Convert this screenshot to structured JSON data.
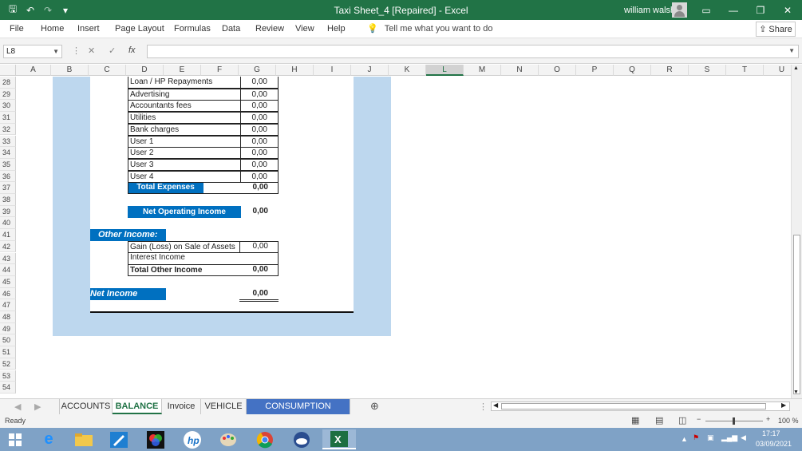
{
  "window": {
    "title": "Taxi Sheet_4 [Repaired] - Excel",
    "user": "william walsh"
  },
  "quick_access": {
    "save": "🖫",
    "undo": "↶",
    "redo": "↷",
    "customize": "▾"
  },
  "menu": [
    "File",
    "Home",
    "Insert",
    "Page Layout",
    "Formulas",
    "Data",
    "Review",
    "View",
    "Help"
  ],
  "tell_me": "Tell me what you want to do",
  "share": "Share",
  "formula_bar": {
    "name_box": "L8",
    "formula": "",
    "fx": "fx"
  },
  "columns": [
    "A",
    "B",
    "C",
    "D",
    "E",
    "F",
    "G",
    "H",
    "I",
    "J",
    "K",
    "L",
    "M",
    "N",
    "O",
    "P",
    "Q",
    "R",
    "S",
    "T",
    "U"
  ],
  "selected_column": "L",
  "rows": [
    "28",
    "29",
    "30",
    "31",
    "32",
    "33",
    "34",
    "35",
    "36",
    "37",
    "38",
    "39",
    "40",
    "41",
    "42",
    "43",
    "44",
    "45",
    "46",
    "47",
    "48",
    "49",
    "50",
    "51",
    "52",
    "53",
    "54"
  ],
  "expenses": [
    {
      "label": "Loan / HP Repayments",
      "value": "0,00"
    },
    {
      "label": "Advertising",
      "value": "0,00"
    },
    {
      "label": "Accountants fees",
      "value": "0,00"
    },
    {
      "label": "Utilities",
      "value": "0,00"
    },
    {
      "label": "Bank charges",
      "value": "0,00"
    },
    {
      "label": "User 1",
      "value": "0,00"
    },
    {
      "label": "User 2",
      "value": "0,00"
    },
    {
      "label": "User 3",
      "value": "0,00"
    },
    {
      "label": "User 4",
      "value": "0,00"
    }
  ],
  "total_expenses": {
    "label": "Total Expenses",
    "value": "0,00"
  },
  "net_operating_income": {
    "label": "Net Operating Income",
    "value": "0,00"
  },
  "other_income": {
    "header": "Other Income:",
    "items": [
      {
        "label": "Gain (Loss) on Sale of Assets",
        "value": "0,00"
      },
      {
        "label": "Interest Income",
        "value": ""
      }
    ],
    "total": {
      "label": "Total Other Income",
      "value": "0,00"
    }
  },
  "net_income": {
    "label": "Net Income (Loss)",
    "value": "0,00"
  },
  "sheet_tabs": [
    "ACCOUNTS",
    "BALANCE",
    "Invoice",
    "VEHICLE",
    "CONSUMPTION TRACKER"
  ],
  "active_tab": "BALANCE",
  "status": {
    "ready": "Ready",
    "zoom": "100 %"
  },
  "clock": {
    "time": "17:17",
    "date": "03/09/2021"
  },
  "colors": {
    "excel_green": "#217346",
    "header_blue": "#0070c0",
    "band_blue": "#bdd7ee",
    "tab_blue": "#4472c4"
  }
}
